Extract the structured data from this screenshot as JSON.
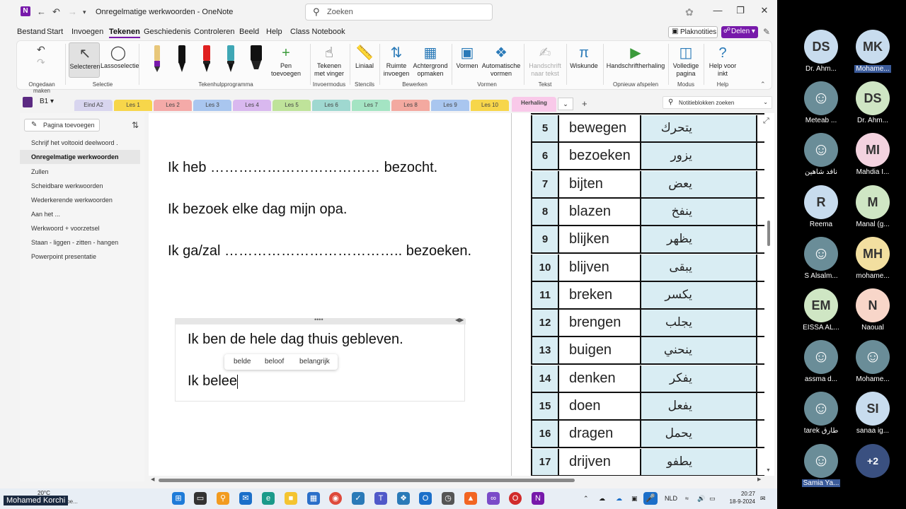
{
  "titlebar": {
    "app": "N",
    "title": "Onregelmatige werkwoorden - OneNote",
    "search_placeholder": "Zoeken"
  },
  "menu": {
    "items": [
      "Bestand",
      "Start",
      "Invoegen",
      "Tekenen",
      "Geschiedenis",
      "Controleren",
      "Beeld",
      "Help",
      "Class Notebook"
    ],
    "active": "Tekenen",
    "plaknotities": "Plaknotities",
    "delen": "Delen"
  },
  "ribbon": {
    "undo_label": "Ongedaan maken",
    "selecteren": "Selecteren",
    "lassoselectie": "Lassoselectie",
    "selectie_group": "Selectie",
    "pen_toevoegen": "Pen toevoegen",
    "tekenhulp_group": "Tekenhulpprogramma",
    "tekenen_met_vinger": "Tekenen met vinger",
    "invoermodus_group": "Invoermodus",
    "liniaal": "Liniaal",
    "stencils_group": "Stencils",
    "ruimte_invoegen": "Ruimte invoegen",
    "achtergrond_opmaken": "Achtergrond opmaken",
    "bewerken_group": "Bewerken",
    "vormen": "Vormen",
    "automatische_vormen": "Automatische vormen",
    "vormen_group": "Vormen",
    "handschrift_naar_tekst": "Handschrift naar tekst",
    "tekst_group": "Tekst",
    "wiskunde": "Wiskunde",
    "handschriftherhaling": "Handschriftherhaling",
    "opnieuw_group": "Opnieuw afspelen",
    "volledige_pagina": "Volledige pagina",
    "modus_group": "Modus",
    "help_voor_inkt": "Help voor inkt",
    "help_group": "Help",
    "pen_colors": [
      "#e8c77a",
      "#111111",
      "#e02020",
      "#3fa7b5",
      "#111111"
    ]
  },
  "notebook": {
    "name": "B1"
  },
  "tabs": [
    {
      "label": "Eind A2",
      "color": "#d8d5ef"
    },
    {
      "label": "Les 1",
      "color": "#f7d64a"
    },
    {
      "label": "Les 2",
      "color": "#f4aaa8"
    },
    {
      "label": "Les 3",
      "color": "#a9c6ef"
    },
    {
      "label": "Les 4",
      "color": "#d9b8ef"
    },
    {
      "label": "Les 5",
      "color": "#bfe39a"
    },
    {
      "label": "Les 6",
      "color": "#9fd8d0"
    },
    {
      "label": "Les 7",
      "color": "#a4e4c3"
    },
    {
      "label": "Les 8",
      "color": "#f3a9a0"
    },
    {
      "label": "Les 9",
      "color": "#a9c6ef"
    },
    {
      "label": "Les 10",
      "color": "#f7d64a"
    },
    {
      "label": "Herhaling",
      "color": "#f9c9e9"
    }
  ],
  "notebook_search": "Notitieblokken zoeken",
  "sidebar": {
    "add_page": "Pagina toevoegen",
    "pages": [
      "Schrijf het voltooid deelwoord .",
      "Onregelmatige werkwoorden",
      "Zullen",
      "Scheidbare werkwoorden",
      "Wederkerende werkwoorden",
      "Aan het ...",
      "Werkwoord + voorzetsel",
      "Staan - liggen - zitten - hangen",
      "Powerpoint presentatie"
    ],
    "active_index": 1
  },
  "content": {
    "line1": "Ik heb ……………………………… bezocht.",
    "line2": "Ik bezoek elke dag mijn opa.",
    "line3": "Ik ga/zal ……………………………….. bezoeken.",
    "note_line1": "Ik ben de hele dag thuis gebleven.",
    "note_line2": "Ik belee",
    "suggestions": [
      "belde",
      "beloof",
      "belangrijk"
    ]
  },
  "verbs": [
    {
      "n": "5",
      "nl": "bewegen",
      "ar": "يتحرك"
    },
    {
      "n": "6",
      "nl": "bezoeken",
      "ar": "يزور"
    },
    {
      "n": "7",
      "nl": "bijten",
      "ar": "يعض"
    },
    {
      "n": "8",
      "nl": "blazen",
      "ar": "ينفخ"
    },
    {
      "n": "9",
      "nl": "blijken",
      "ar": "يظهر"
    },
    {
      "n": "10",
      "nl": "blijven",
      "ar": "يبقى"
    },
    {
      "n": "11",
      "nl": "breken",
      "ar": "يكسر"
    },
    {
      "n": "12",
      "nl": "brengen",
      "ar": "يجلب"
    },
    {
      "n": "13",
      "nl": "buigen",
      "ar": "ينحني"
    },
    {
      "n": "14",
      "nl": "denken",
      "ar": "يفكر"
    },
    {
      "n": "15",
      "nl": "doen",
      "ar": "يفعل"
    },
    {
      "n": "16",
      "nl": "dragen",
      "ar": "يحمل"
    },
    {
      "n": "17",
      "nl": "drijven",
      "ar": "يطفو"
    }
  ],
  "taskbar": {
    "weather_temp": "20°C",
    "weather_text": "s be...",
    "lang": "NLD",
    "time": "20:27",
    "date": "18-9-2024",
    "self_name": "Mohamed Korchi"
  },
  "participants": [
    {
      "initials": "DS",
      "name": "Dr. Ahm...",
      "bg": "#c8dcee",
      "photo": false
    },
    {
      "initials": "MK",
      "name": "Mohame...",
      "bg": "#c8dcee",
      "photo": false,
      "highlight": true
    },
    {
      "initials": "",
      "name": "Meteab ...",
      "bg": "#6a8d98",
      "photo": true
    },
    {
      "initials": "DS",
      "name": "Dr. Ahm...",
      "bg": "#cfe6c4",
      "photo": false
    },
    {
      "initials": "",
      "name": "نافد شاهين",
      "bg": "#6a8d98",
      "photo": true
    },
    {
      "initials": "MI",
      "name": "Mahdia I...",
      "bg": "#f3d2df",
      "photo": false
    },
    {
      "initials": "R",
      "name": "Reema",
      "bg": "#c8dcee",
      "photo": false
    },
    {
      "initials": "M",
      "name": "Manal (g...",
      "bg": "#cfe6c4",
      "photo": false
    },
    {
      "initials": "",
      "name": "S Alsalm...",
      "bg": "#6a8d98",
      "photo": true
    },
    {
      "initials": "MH",
      "name": "mohame...",
      "bg": "#f2dfa0",
      "photo": false
    },
    {
      "initials": "EM",
      "name": "EISSA AL...",
      "bg": "#cfe6c4",
      "photo": false
    },
    {
      "initials": "N",
      "name": "Naoual",
      "bg": "#f8d6c9",
      "photo": false
    },
    {
      "initials": "",
      "name": "assma d...",
      "bg": "#6a8d98",
      "photo": true
    },
    {
      "initials": "",
      "name": "Mohame...",
      "bg": "#6a8d98",
      "photo": true
    },
    {
      "initials": "",
      "name": "tarek طارق",
      "bg": "#6a8d98",
      "photo": true
    },
    {
      "initials": "SI",
      "name": "sanaa ig...",
      "bg": "#c8dcee",
      "photo": false
    },
    {
      "initials": "",
      "name": "Samia Ya...",
      "bg": "#6a8d98",
      "photo": true,
      "highlight": true
    },
    {
      "initials": "+2",
      "name": "",
      "bg": "#3a5080",
      "photo": false
    }
  ]
}
